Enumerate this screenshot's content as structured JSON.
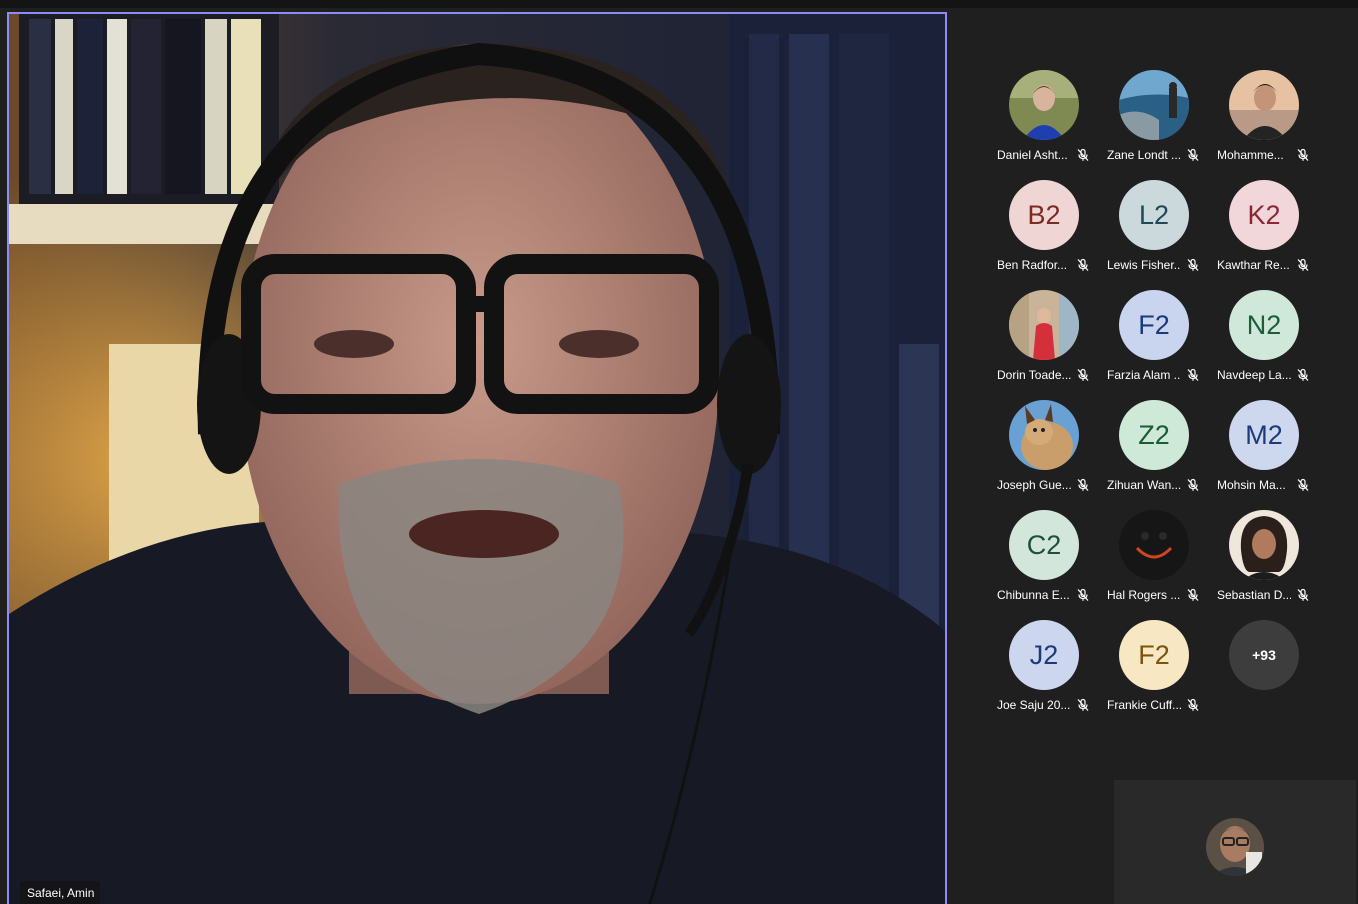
{
  "main_speaker": {
    "name": "Safaei, Amin",
    "highlight_color": "#8b8cf5"
  },
  "participants": [
    {
      "name": "Daniel Asht...",
      "type": "photo",
      "muted": true
    },
    {
      "name": "Zane Londt ...",
      "type": "photo",
      "muted": true
    },
    {
      "name": "Mohamme...",
      "type": "photo",
      "muted": true
    },
    {
      "name": "Ben Radfor...",
      "type": "initials",
      "initials": "B2",
      "bg": "#efd5d3",
      "fg": "#7d2a22",
      "muted": true
    },
    {
      "name": "Lewis Fisher...",
      "type": "initials",
      "initials": "L2",
      "bg": "#ccd9dc",
      "fg": "#1f4953",
      "muted": true
    },
    {
      "name": "Kawthar Re...",
      "type": "initials",
      "initials": "K2",
      "bg": "#f1d7da",
      "fg": "#8a2837",
      "muted": true
    },
    {
      "name": "Dorin Toade...",
      "type": "photo",
      "muted": true
    },
    {
      "name": "Farzia Alam ...",
      "type": "initials",
      "initials": "F2",
      "bg": "#c9d4ee",
      "fg": "#1c3a7a",
      "muted": true
    },
    {
      "name": "Navdeep La...",
      "type": "initials",
      "initials": "N2",
      "bg": "#cfe8d9",
      "fg": "#1c5e3a",
      "muted": true
    },
    {
      "name": "Joseph Gue...",
      "type": "photo",
      "muted": true
    },
    {
      "name": "Zihuan Wan...",
      "type": "initials",
      "initials": "Z2",
      "bg": "#cfe9d8",
      "fg": "#175c36",
      "muted": true
    },
    {
      "name": "Mohsin Ma...",
      "type": "initials",
      "initials": "M2",
      "bg": "#cdd7ee",
      "fg": "#1c3a7a",
      "muted": true
    },
    {
      "name": "Chibunna E...",
      "type": "initials",
      "initials": "C2",
      "bg": "#d3e6dc",
      "fg": "#1e5138",
      "muted": true
    },
    {
      "name": "Hal Rogers ...",
      "type": "photo",
      "muted": true
    },
    {
      "name": "Sebastian D...",
      "type": "photo",
      "muted": true
    },
    {
      "name": "Joe Saju 20...",
      "type": "initials",
      "initials": "J2",
      "bg": "#ccd6ee",
      "fg": "#1c3a7a",
      "muted": true
    },
    {
      "name": "Frankie Cuff...",
      "type": "initials",
      "initials": "F2",
      "bg": "#f7e7c2",
      "fg": "#7a5410",
      "muted": true
    }
  ],
  "overflow": {
    "label": "+93"
  },
  "icons": {
    "mic_off": "mic-off-icon"
  }
}
